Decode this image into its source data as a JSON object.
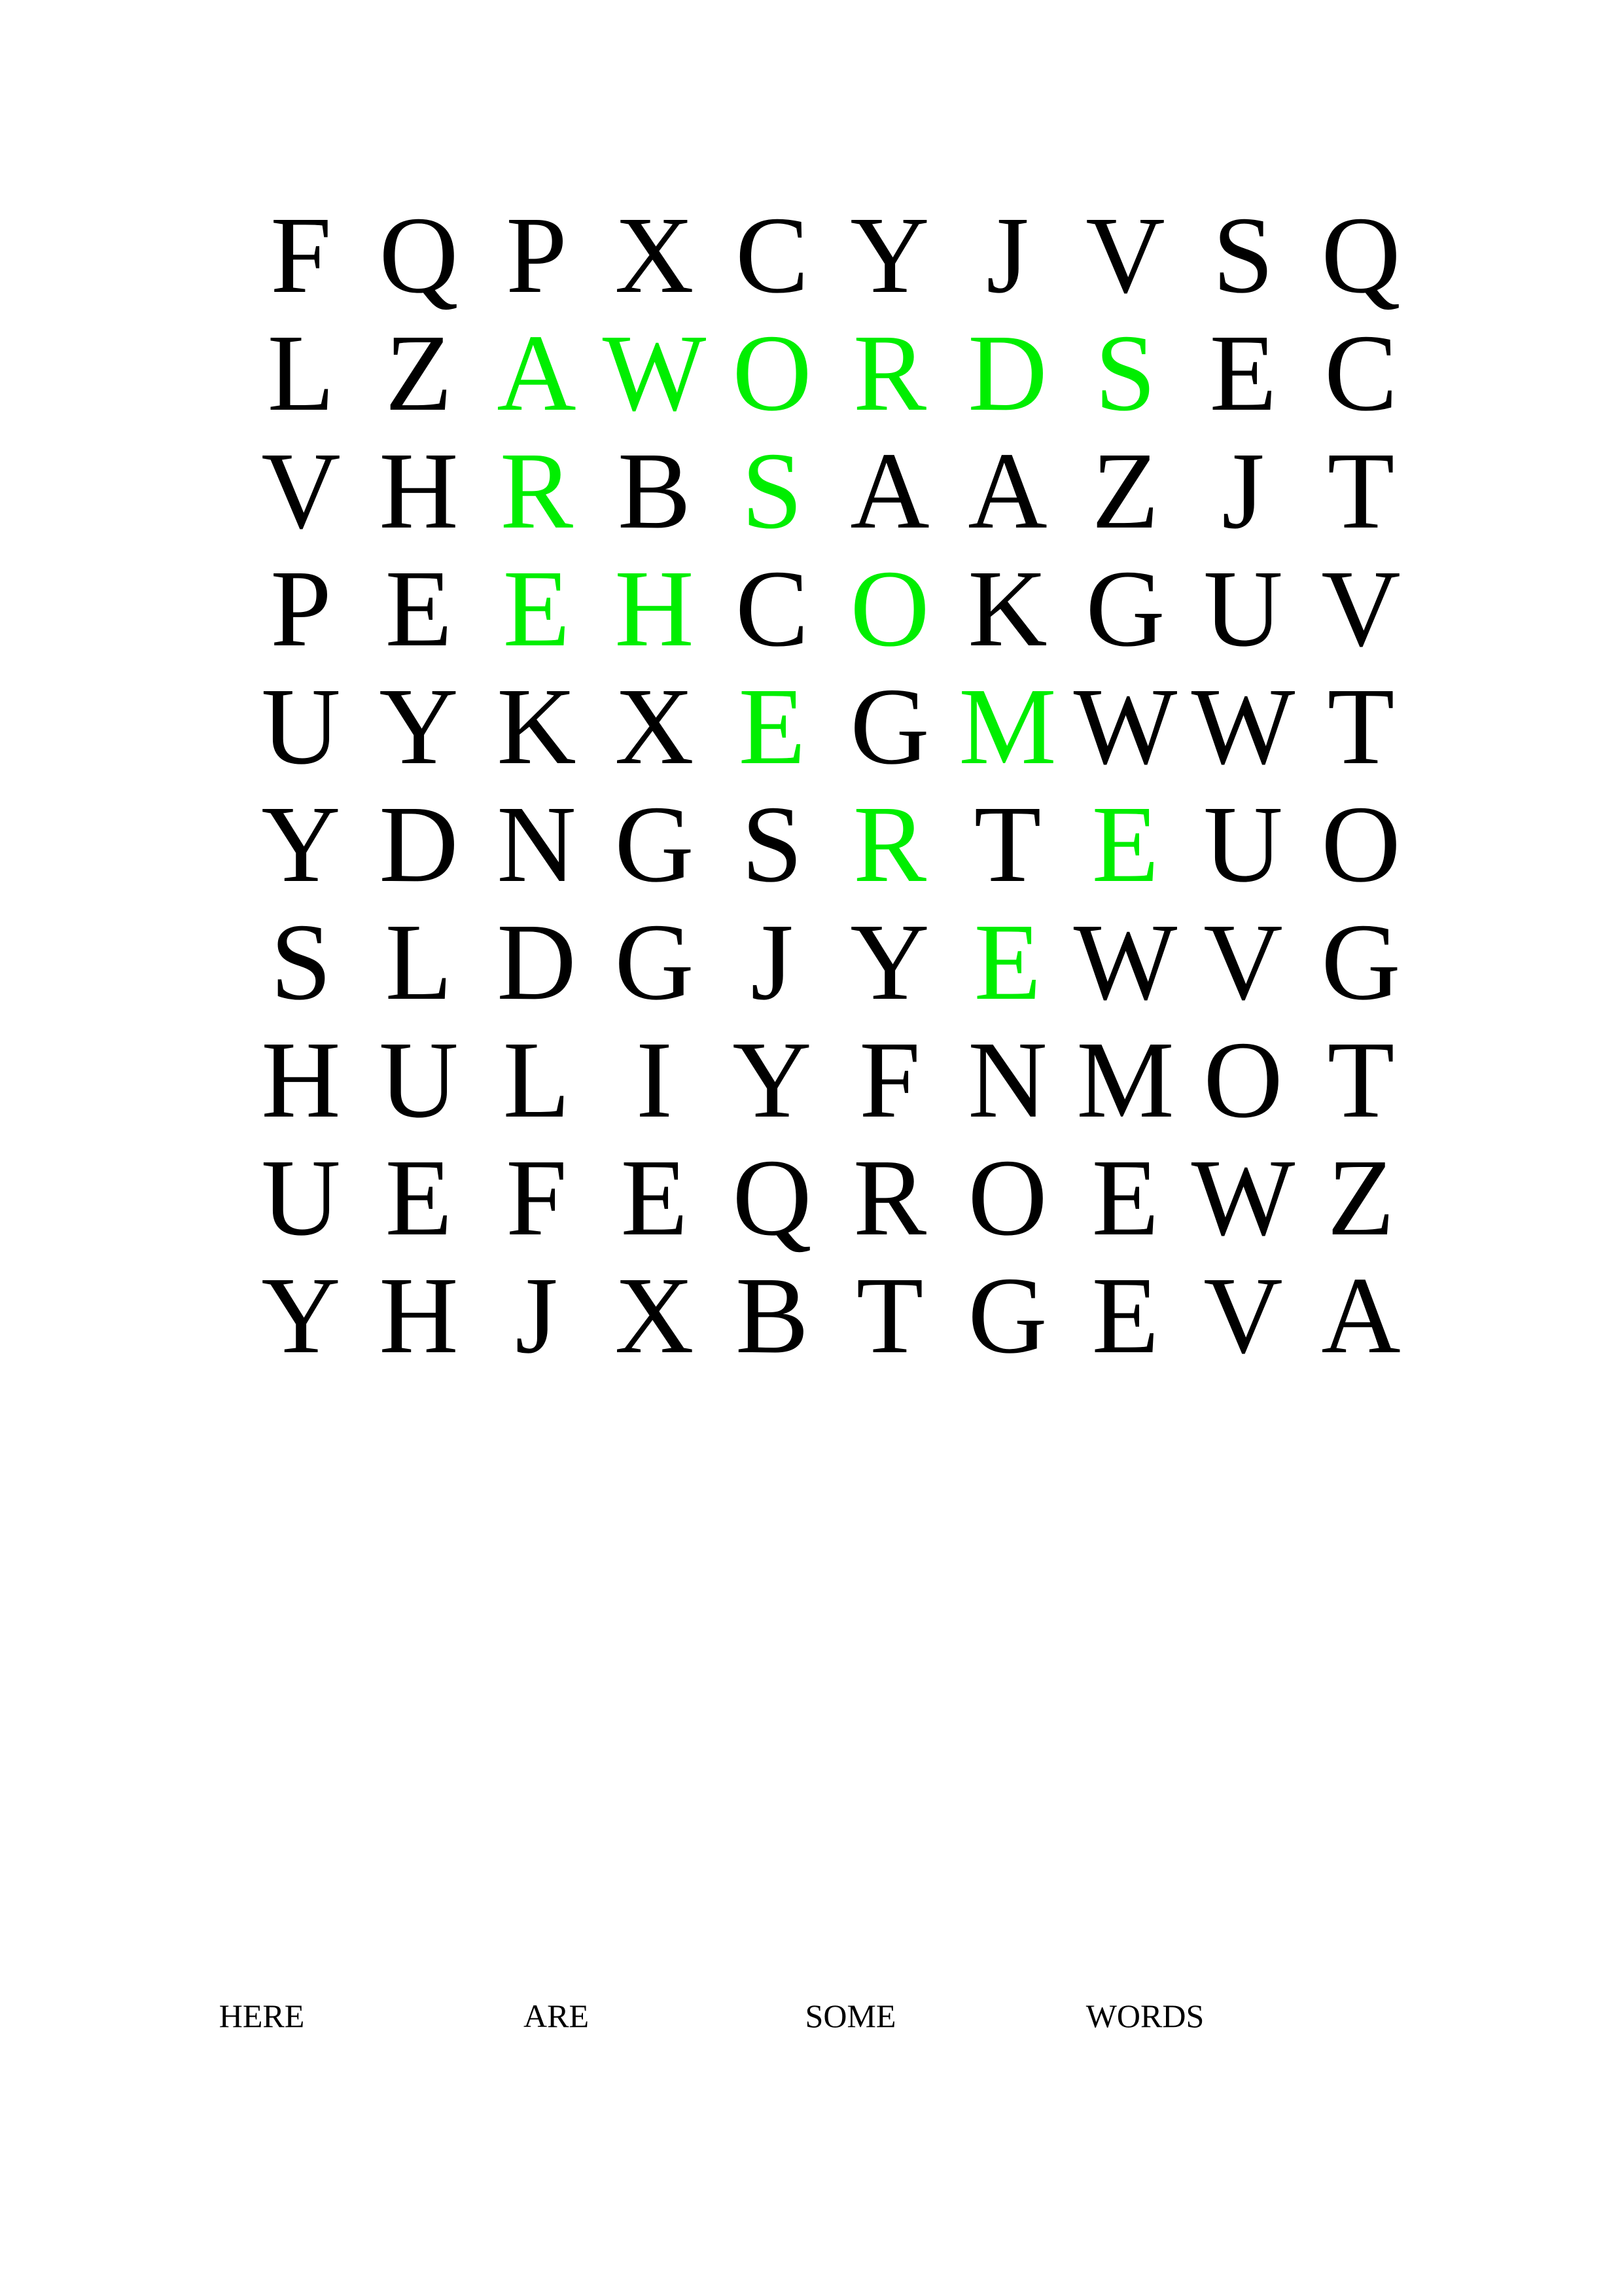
{
  "colors": {
    "background": "#ffffff",
    "letter": "#000000",
    "found_letter": "#00ee00"
  },
  "puzzle": {
    "rows": [
      [
        "F",
        "Q",
        "P",
        "X",
        "C",
        "Y",
        "J",
        "V",
        "S",
        "Q"
      ],
      [
        "L",
        "Z",
        "A",
        "W",
        "O",
        "R",
        "D",
        "S",
        "E",
        "C"
      ],
      [
        "V",
        "H",
        "R",
        "B",
        "S",
        "A",
        "A",
        "Z",
        "J",
        "T"
      ],
      [
        "P",
        "E",
        "E",
        "H",
        "C",
        "O",
        "K",
        "G",
        "U",
        "V"
      ],
      [
        "U",
        "Y",
        "K",
        "X",
        "E",
        "G",
        "M",
        "W",
        "W",
        "T"
      ],
      [
        "Y",
        "D",
        "N",
        "G",
        "S",
        "R",
        "T",
        "E",
        "U",
        "O"
      ],
      [
        "S",
        "L",
        "D",
        "G",
        "J",
        "Y",
        "E",
        "W",
        "V",
        "G"
      ],
      [
        "H",
        "U",
        "L",
        "I",
        "Y",
        "F",
        "N",
        "M",
        "O",
        "T"
      ],
      [
        "U",
        "E",
        "F",
        "E",
        "Q",
        "R",
        "O",
        "E",
        "W",
        "Z"
      ],
      [
        "Y",
        "H",
        "J",
        "X",
        "B",
        "T",
        "G",
        "E",
        "V",
        "A"
      ]
    ],
    "highlighted": [
      [
        0,
        0,
        0,
        0,
        0,
        0,
        0,
        0,
        0,
        0
      ],
      [
        0,
        0,
        1,
        1,
        1,
        1,
        1,
        1,
        0,
        0
      ],
      [
        0,
        0,
        1,
        0,
        1,
        0,
        0,
        0,
        0,
        0
      ],
      [
        0,
        0,
        1,
        1,
        0,
        1,
        0,
        0,
        0,
        0
      ],
      [
        0,
        0,
        0,
        0,
        1,
        0,
        1,
        0,
        0,
        0
      ],
      [
        0,
        0,
        0,
        0,
        0,
        1,
        0,
        1,
        0,
        0
      ],
      [
        0,
        0,
        0,
        0,
        0,
        0,
        1,
        0,
        0,
        0
      ],
      [
        0,
        0,
        0,
        0,
        0,
        0,
        0,
        0,
        0,
        0
      ],
      [
        0,
        0,
        0,
        0,
        0,
        0,
        0,
        0,
        0,
        0
      ],
      [
        0,
        0,
        0,
        0,
        0,
        0,
        0,
        0,
        0,
        0
      ]
    ]
  },
  "word_list": [
    "HERE",
    "ARE",
    "SOME",
    "WORDS"
  ]
}
